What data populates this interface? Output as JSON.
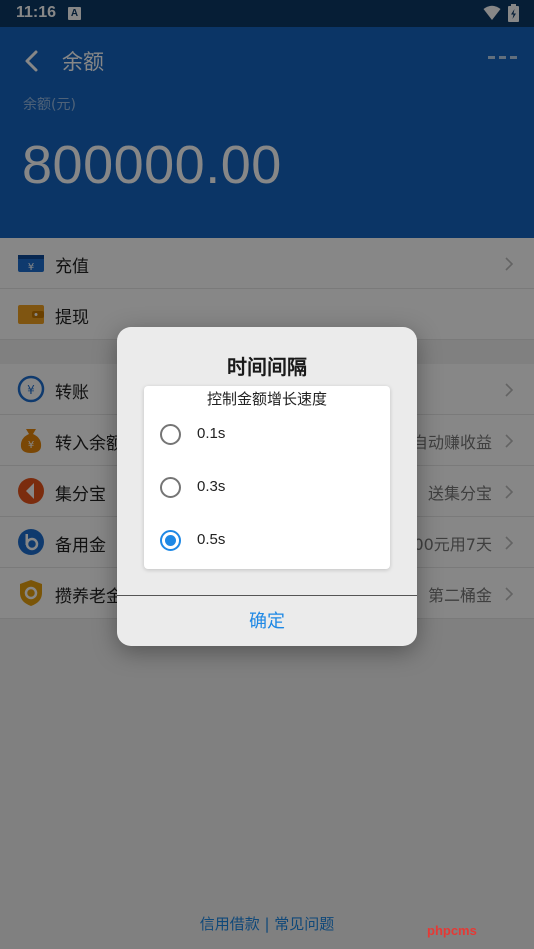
{
  "status_bar": {
    "time": "11:16",
    "notif_icon": "A"
  },
  "header": {
    "title": "余额",
    "balance_label": "余额(元)",
    "balance_amount": "800000.00"
  },
  "list_group_1": [
    {
      "label": "充值",
      "icon": "recharge-icon",
      "extra": ""
    },
    {
      "label": "提现",
      "icon": "wallet-icon",
      "extra": ""
    }
  ],
  "list_group_2": [
    {
      "label": "转账",
      "icon": "transfer-icon",
      "extra": ""
    },
    {
      "label": "转入余额",
      "icon": "money-bag-icon",
      "extra": "自动赚收益"
    },
    {
      "label": "集分宝",
      "icon": "points-icon",
      "extra": "送集分宝"
    },
    {
      "label": "备用金",
      "icon": "reserve-fund-icon",
      "extra": "500元用7天"
    },
    {
      "label": "攒养老金",
      "icon": "pension-shield-icon",
      "extra": "第二桶金"
    }
  ],
  "footer": {
    "links": "信用借款 | 常见问题"
  },
  "watermark": "phpcms",
  "dialog": {
    "title": "时间间隔",
    "subtitle": "控制金额增长速度",
    "options": [
      {
        "label": "0.1s",
        "checked": false
      },
      {
        "label": "0.3s",
        "checked": false
      },
      {
        "label": "0.5s",
        "checked": true
      }
    ],
    "confirm_label": "确定"
  },
  "colors": {
    "primary": "#1565c0",
    "accent": "#1e88e5",
    "status_bar": "#0d3a66"
  }
}
